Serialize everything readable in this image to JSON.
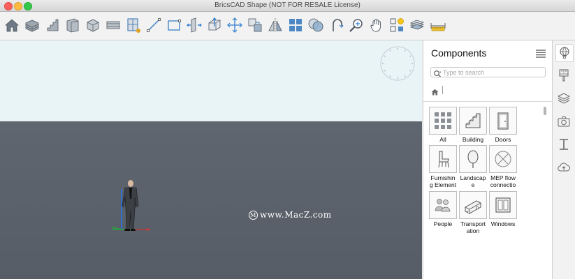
{
  "window": {
    "title": "BricsCAD Shape (NOT FOR RESALE License)"
  },
  "toolbar": {
    "tools": [
      "home-icon",
      "building-block-icon",
      "stairs-icon",
      "wall-icon",
      "solid-box-icon",
      "slab-icon",
      "window-insert-icon",
      "line-icon",
      "rectangle-icon",
      "push-pull-icon",
      "extrude-icon",
      "move-icon",
      "copy-icon",
      "mirror-icon",
      "array-icon",
      "union-icon",
      "rotate-icon",
      "zoom-icon",
      "pan-icon",
      "render-icon",
      "layers-icon",
      "measure-icon"
    ]
  },
  "viewport": {
    "watermark": "www.MacZ.com",
    "watermark_icon": "M"
  },
  "components_panel": {
    "title": "Components",
    "search_placeholder": "Type to search",
    "tiles": [
      {
        "label": "All",
        "icon": "grid-icon"
      },
      {
        "label": "Building",
        "icon": "stairs-icon"
      },
      {
        "label": "Doors",
        "icon": "door-icon"
      },
      {
        "label": "Furnishin g Element",
        "icon": "chair-icon"
      },
      {
        "label": "Landscap e",
        "icon": "tree-icon"
      },
      {
        "label": "MEP flow connectio",
        "icon": "pipe-icon"
      },
      {
        "label": "People",
        "icon": "people-icon"
      },
      {
        "label": "Transport ation",
        "icon": "truck-icon"
      },
      {
        "label": "Windows",
        "icon": "window-icon"
      }
    ]
  },
  "right_rail": [
    "balloon-icon",
    "paint-brush-icon",
    "layers-stack-icon",
    "camera-icon",
    "ibeam-icon",
    "cloud-upload-icon"
  ],
  "colors": {
    "sky": "#e9f4f6",
    "ground": "#5c636c",
    "accent": "#2f7fd0"
  }
}
